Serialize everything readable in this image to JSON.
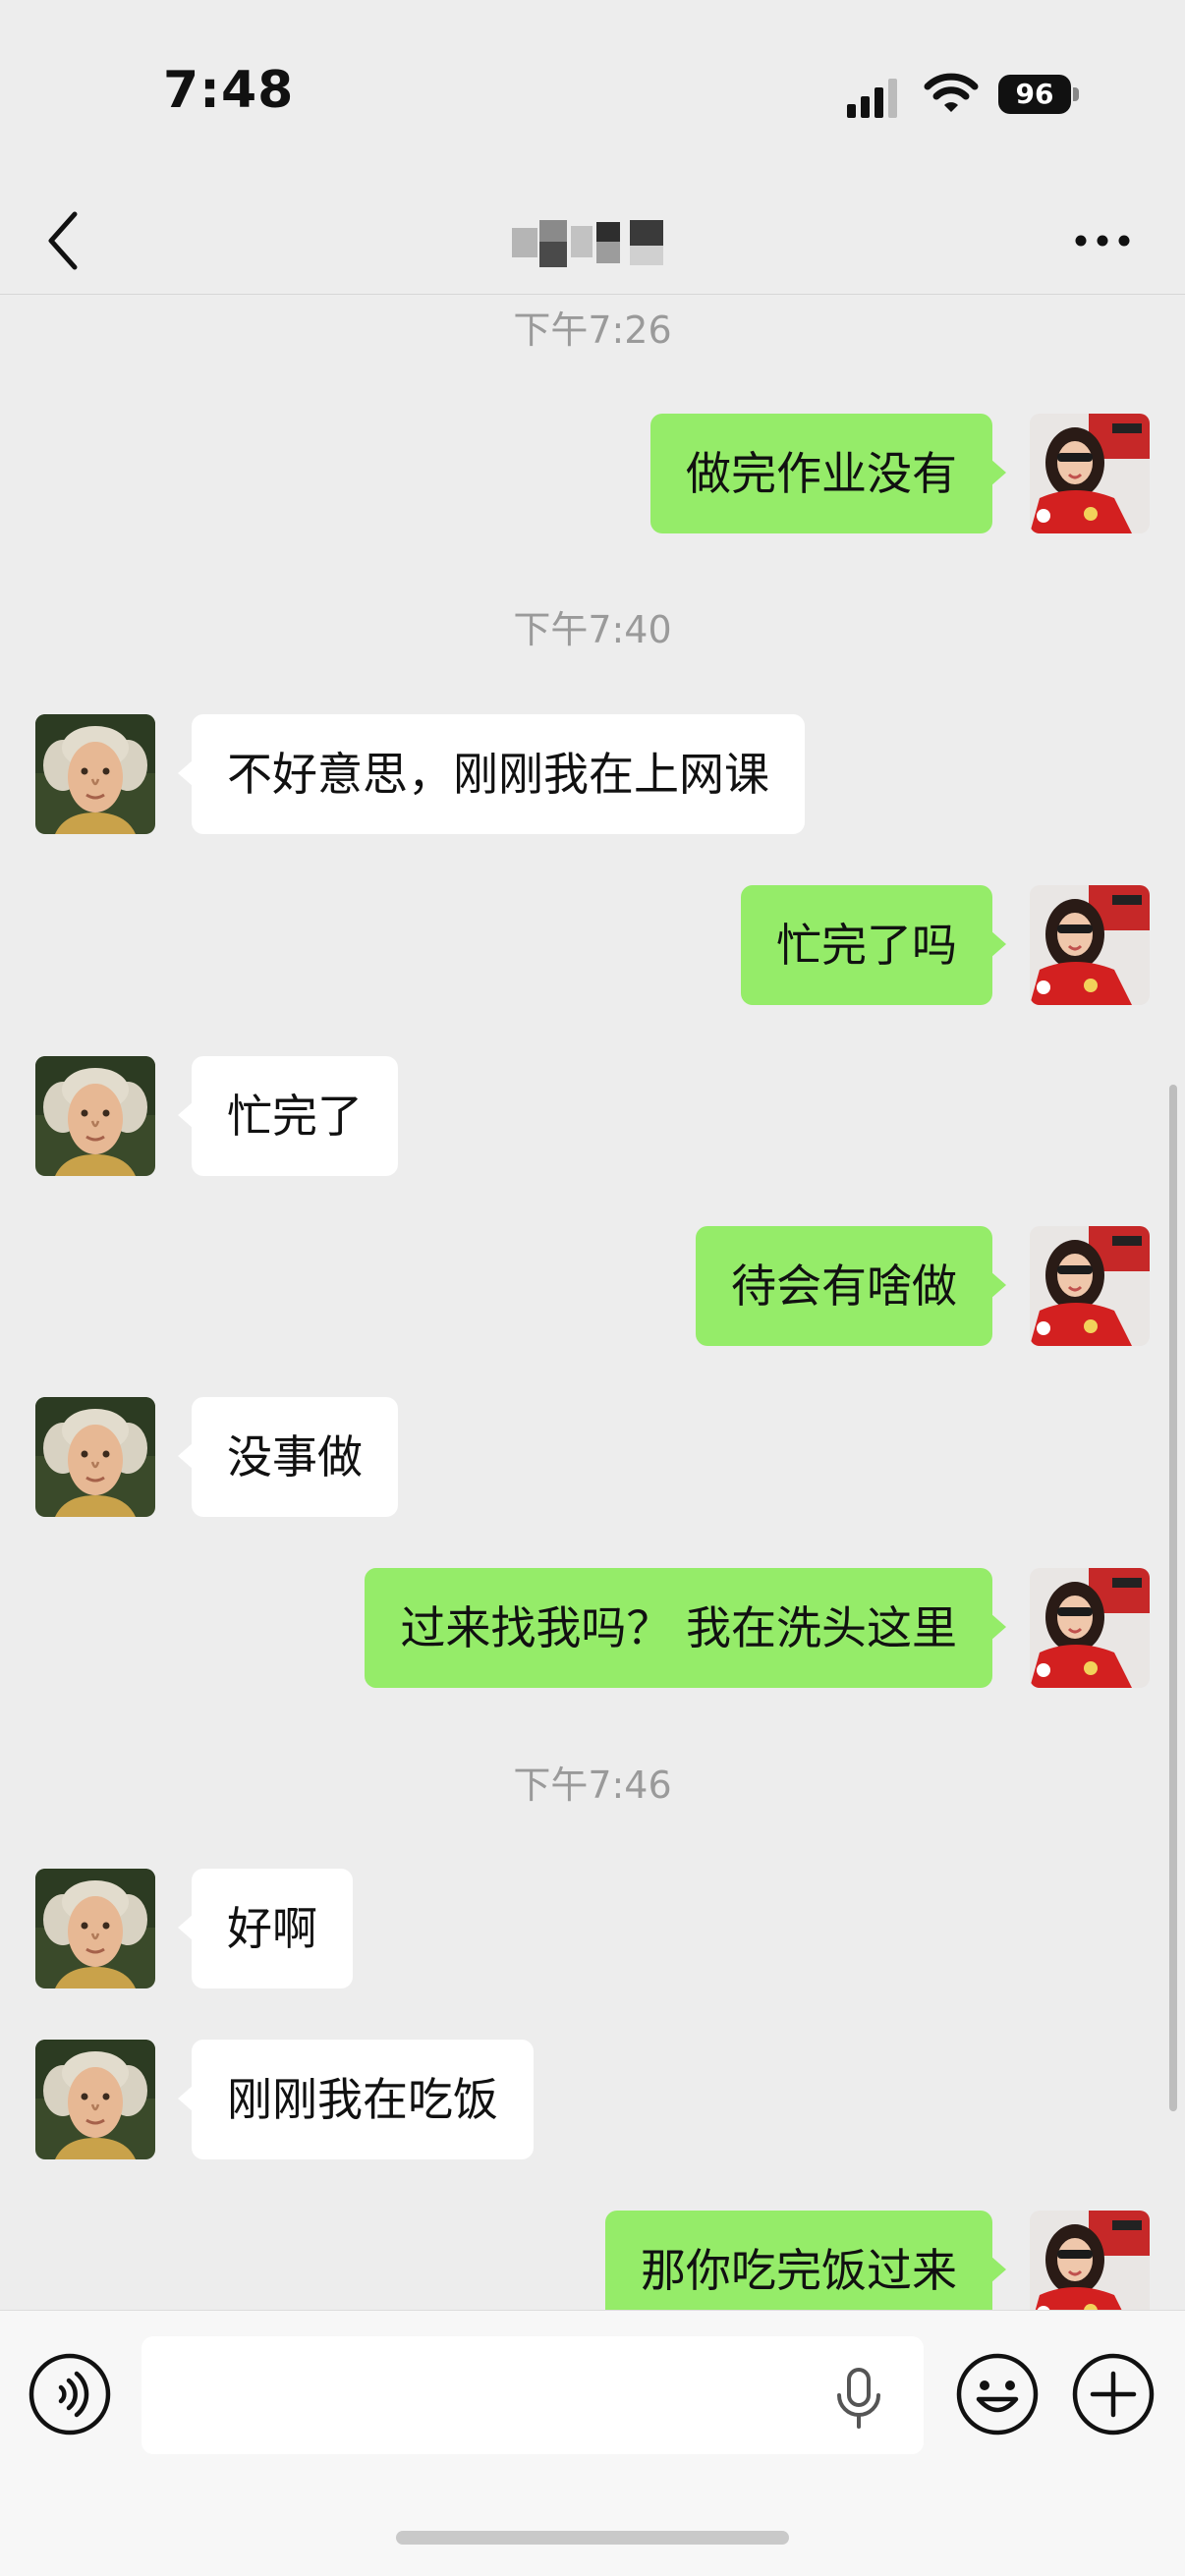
{
  "status_bar": {
    "time": "7:48",
    "battery": "96",
    "icons": [
      "signal-icon",
      "wifi-icon",
      "battery-icon"
    ]
  },
  "header": {
    "title": "",
    "icons": [
      "back-icon",
      "more-icon"
    ]
  },
  "chat": {
    "messages": [
      {
        "type": "timestamp",
        "text": "下午7:26"
      },
      {
        "type": "message",
        "side": "out",
        "text": "做完作业没有"
      },
      {
        "type": "timestamp",
        "text": "下午7:40"
      },
      {
        "type": "message",
        "side": "in",
        "text": "不好意思，刚刚我在上网课"
      },
      {
        "type": "message",
        "side": "out",
        "text": "忙完了吗"
      },
      {
        "type": "message",
        "side": "in",
        "text": "忙完了"
      },
      {
        "type": "message",
        "side": "out",
        "text": "待会有啥做"
      },
      {
        "type": "message",
        "side": "in",
        "text": "没事做"
      },
      {
        "type": "message",
        "side": "out",
        "text": "过来找我吗？ 我在洗头这里"
      },
      {
        "type": "timestamp",
        "text": "下午7:46"
      },
      {
        "type": "message",
        "side": "in",
        "text": "好啊"
      },
      {
        "type": "message",
        "side": "in",
        "text": "刚刚我在吃饭"
      },
      {
        "type": "message",
        "side": "out",
        "text": "那你吃完饭过来"
      }
    ]
  },
  "input_bar": {
    "placeholder": "",
    "icons": [
      "voice-icon",
      "mic-icon",
      "emoji-icon",
      "plus-icon"
    ]
  },
  "colors": {
    "background": "#ededed",
    "outgoing_bubble": "#95ec69",
    "incoming_bubble": "#ffffff",
    "timestamp": "#9a9a9a"
  }
}
